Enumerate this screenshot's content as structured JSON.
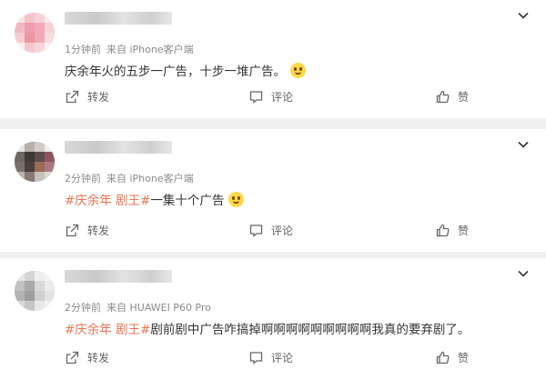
{
  "comments": [
    {
      "time": "1分钟前",
      "source": "来自 iPhone客户端",
      "text": "庆余年火的五步一广告，十步一堆广告。",
      "tag": "",
      "emoji": "smile-emoji",
      "actions": {
        "share": "转发",
        "comment": "评论",
        "like": "赞"
      }
    },
    {
      "time": "2分钟前",
      "source": "来自 iPhone客户端",
      "tag": "#庆余年 剧王#",
      "text": "一集十个广告",
      "emoji": "wink-emoji",
      "actions": {
        "share": "转发",
        "comment": "评论",
        "like": "赞"
      }
    },
    {
      "time": "2分钟前",
      "source": "来自 HUAWEI P60 Pro",
      "tag": "#庆余年 剧王#",
      "text": "剧前剧中广告咋搞掉啊啊啊啊啊啊啊啊啊我真的要弃剧了。",
      "emoji": "",
      "actions": {
        "share": "转发",
        "comment": "评论",
        "like": "赞"
      }
    }
  ],
  "colors": {
    "tag": "#eb7350",
    "meta": "#8a8a8a",
    "background": "#f0f0f0"
  }
}
